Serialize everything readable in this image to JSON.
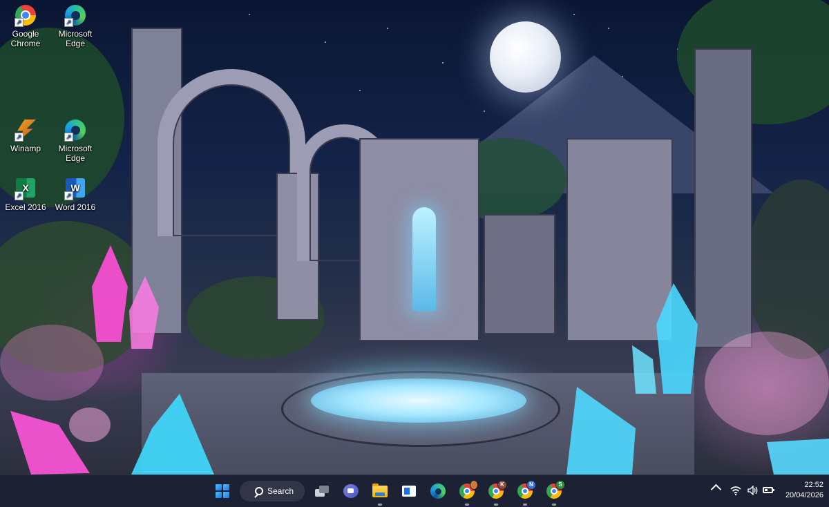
{
  "desktop": {
    "icons": [
      {
        "label": "Google\nChrome",
        "icon": "chrome-icon"
      },
      {
        "label": "Microsoft\nEdge",
        "icon": "edge-icon"
      },
      {
        "label": "Winamp",
        "icon": "winamp-icon"
      },
      {
        "label": "Microsoft\nEdge",
        "icon": "edge-icon"
      },
      {
        "label": "Excel 2016",
        "icon": "excel-icon"
      },
      {
        "label": "Word 2016",
        "icon": "word-icon"
      }
    ]
  },
  "taskbar": {
    "search_label": "Search",
    "apps": [
      {
        "name": "Start",
        "icon": "windows-start-icon"
      },
      {
        "name": "Task View",
        "icon": "task-view-icon"
      },
      {
        "name": "Chat",
        "icon": "chat-icon"
      },
      {
        "name": "File Explorer",
        "icon": "folder-icon"
      },
      {
        "name": "Widgets",
        "icon": "widgets-icon"
      },
      {
        "name": "Microsoft Edge",
        "icon": "edge-icon"
      },
      {
        "name": "Google Chrome",
        "icon": "chrome-icon",
        "badge": ""
      },
      {
        "name": "Google Chrome",
        "icon": "chrome-icon",
        "badge": "K"
      },
      {
        "name": "Google Chrome",
        "icon": "chrome-icon",
        "badge": "N"
      },
      {
        "name": "Google Chrome",
        "icon": "chrome-icon",
        "badge": "S"
      }
    ],
    "badge_colors": {
      "K": "#8a4b3c",
      "N": "#3d6fd8",
      "S": "#2f8f3c",
      "default": "#d07a3a"
    },
    "tray": {
      "icons": [
        "chevron-up-icon",
        "wifi-icon",
        "volume-icon",
        "battery-icon"
      ],
      "time": "22:52",
      "date": "20/04/2026"
    }
  }
}
